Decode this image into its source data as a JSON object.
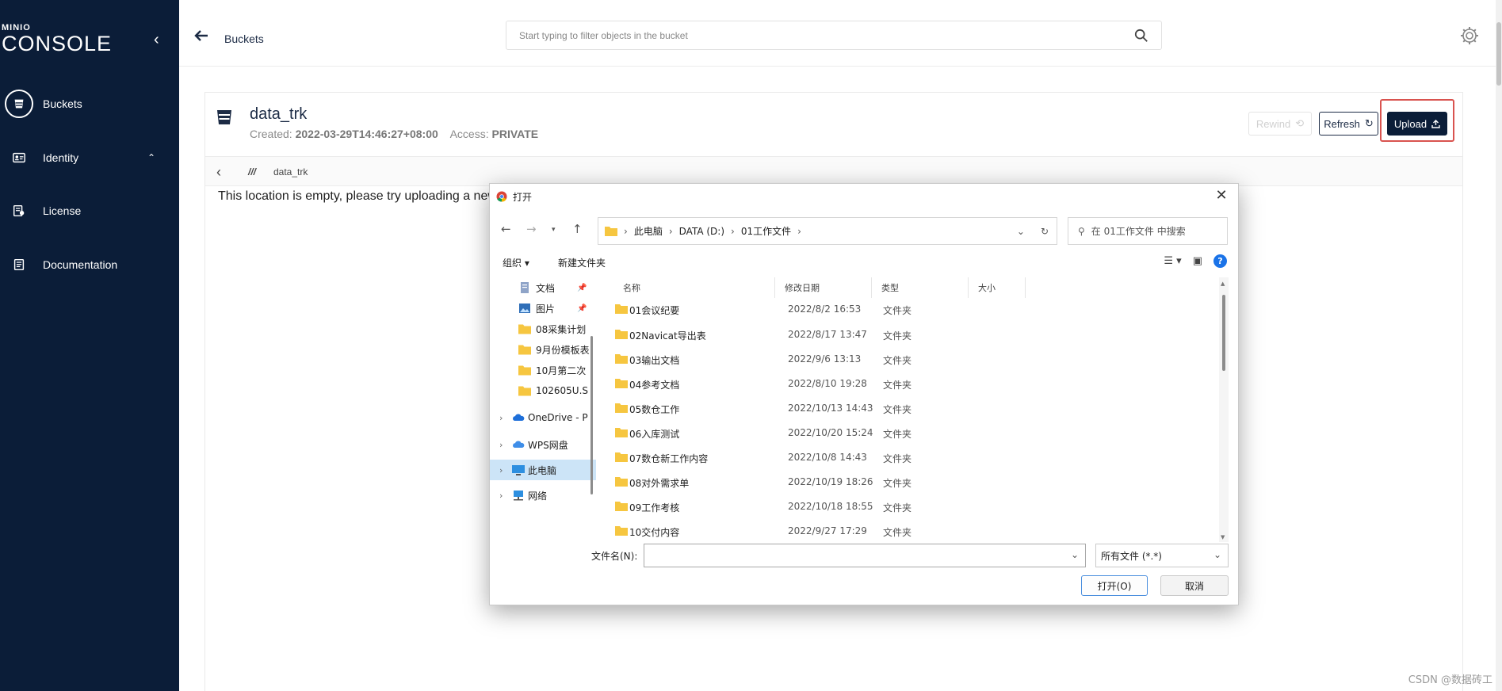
{
  "sidebar": {
    "logo_top": "MINIO",
    "logo_bottom": "CONSOLE",
    "items": [
      {
        "label": "Buckets",
        "icon": "bucket-icon"
      },
      {
        "label": "Identity",
        "icon": "identity-icon"
      },
      {
        "label": "License",
        "icon": "license-icon"
      },
      {
        "label": "Documentation",
        "icon": "documentation-icon"
      }
    ]
  },
  "header": {
    "breadcrumb": "Buckets",
    "search_placeholder": "Start typing to filter objects in the bucket"
  },
  "bucket": {
    "name": "data_trk",
    "created_label": "Created:",
    "created_value": "2022-03-29T14:46:27+08:00",
    "access_label": "Access:",
    "access_value": "PRIVATE",
    "buttons": {
      "rewind": "Rewind",
      "refresh": "Refresh",
      "upload": "Upload"
    },
    "path": "data_trk",
    "empty_message": "This location is empty, please try uploading a new"
  },
  "dialog": {
    "title": "打开",
    "path": [
      "此电脑",
      "DATA (D:)",
      "01工作文件"
    ],
    "search_placeholder": "在 01工作文件 中搜索",
    "commands": {
      "organize": "组织 ▾",
      "new_folder": "新建文件夹"
    },
    "tree": [
      {
        "label": "文档",
        "icon": "document-icon",
        "pinned": true
      },
      {
        "label": "图片",
        "icon": "picture-icon",
        "pinned": true
      },
      {
        "label": "08采集计划",
        "icon": "folder-icon"
      },
      {
        "label": "9月份模板表",
        "icon": "folder-icon"
      },
      {
        "label": "10月第二次",
        "icon": "folder-icon"
      },
      {
        "label": "102605U.S",
        "icon": "folder-icon"
      },
      {
        "label": "OneDrive - P",
        "icon": "onedrive-icon"
      },
      {
        "label": "WPS网盘",
        "icon": "wps-cloud-icon"
      },
      {
        "label": "此电脑",
        "icon": "computer-icon"
      },
      {
        "label": "网络",
        "icon": "network-icon"
      }
    ],
    "columns": [
      "名称",
      "修改日期",
      "类型",
      "大小"
    ],
    "files": [
      {
        "name": "01会议纪要",
        "date": "2022/8/2 16:53",
        "type": "文件夹"
      },
      {
        "name": "02Navicat导出表",
        "date": "2022/8/17 13:47",
        "type": "文件夹"
      },
      {
        "name": "03输出文档",
        "date": "2022/9/6 13:13",
        "type": "文件夹"
      },
      {
        "name": "04参考文档",
        "date": "2022/8/10 19:28",
        "type": "文件夹"
      },
      {
        "name": "05数仓工作",
        "date": "2022/10/13 14:43",
        "type": "文件夹"
      },
      {
        "name": "06入库测试",
        "date": "2022/10/20 15:24",
        "type": "文件夹"
      },
      {
        "name": "07数仓新工作内容",
        "date": "2022/10/8 14:43",
        "type": "文件夹"
      },
      {
        "name": "08对外需求单",
        "date": "2022/10/19 18:26",
        "type": "文件夹"
      },
      {
        "name": "09工作考核",
        "date": "2022/10/18 18:55",
        "type": "文件夹"
      },
      {
        "name": "10交付内容",
        "date": "2022/9/27 17:29",
        "type": "文件夹"
      }
    ],
    "filename_label": "文件名(N):",
    "filename_value": "",
    "filetype": "所有文件 (*.*)",
    "open": "打开(O)",
    "cancel": "取消"
  },
  "watermark": "CSDN @数据砖工",
  "colors": {
    "sidebar_bg": "#0b1d38",
    "upload_bg": "#0b1d38",
    "highlight": "#d9534f",
    "folder": "#f6c640"
  }
}
